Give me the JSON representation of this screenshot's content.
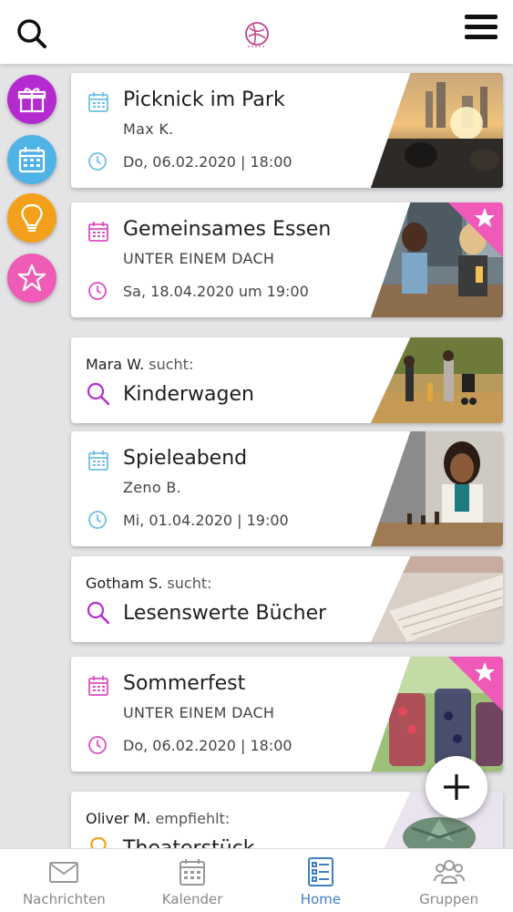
{
  "colors": {
    "accent_blue": "#3e7fc4",
    "event_blue": "#6ebfe3",
    "event_pink": "#d94fbf",
    "ribbon_pink": "#ef5ab8",
    "side_purple": "#b32bcf",
    "side_cyan": "#4fb3e6",
    "side_orange": "#f3a11c",
    "side_pink": "#ee5cb5"
  },
  "header": {
    "search_icon": "search-icon",
    "logo_icon": "app-logo-icon",
    "menu_icon": "hamburger-menu-icon"
  },
  "side_categories": [
    {
      "icon": "gift-icon"
    },
    {
      "icon": "calendar-icon"
    },
    {
      "icon": "lightbulb-icon"
    },
    {
      "icon": "star-icon"
    }
  ],
  "feed": {
    "card1": {
      "title": "Picknick im Park",
      "subtitle": "Max K.",
      "datetime": "Do, 06.02.2020 | 18:00"
    },
    "card2": {
      "title": "Gemeinsames Essen",
      "subtitle": "UNTER EINEM DACH",
      "datetime": "Sa, 18.04.2020 um 19:00",
      "featured": true
    },
    "card3": {
      "user": "Mara W.",
      "verb": "sucht:",
      "title": "Kinderwagen"
    },
    "card4": {
      "title": "Spieleabend",
      "subtitle": "Zeno B.",
      "datetime": "Mi, 01.04.2020 | 19:00"
    },
    "card5": {
      "user": "Gotham S.",
      "verb": "sucht:",
      "title": "Lesenswerte Bücher"
    },
    "card6": {
      "title": "Sommerfest",
      "subtitle": "UNTER EINEM DACH",
      "datetime": "Do, 06.02.2020 | 18:00",
      "featured": true
    },
    "card7": {
      "user": "Oliver M.",
      "verb": "empfiehlt:",
      "title": "Theaterstück"
    }
  },
  "bottom_nav": [
    {
      "label": "Nachrichten",
      "icon": "mail-icon",
      "active": false
    },
    {
      "label": "Kalender",
      "icon": "calendar-icon",
      "active": false
    },
    {
      "label": "Home",
      "icon": "home-list-icon",
      "active": true
    },
    {
      "label": "Gruppen",
      "icon": "group-icon",
      "active": false
    }
  ]
}
